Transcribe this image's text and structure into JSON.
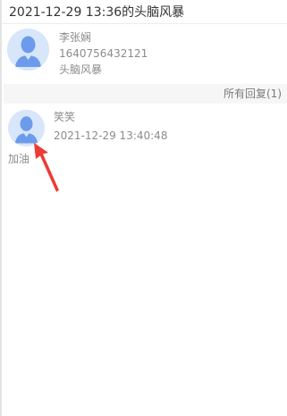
{
  "page_title": "2021-12-29 13:36的头脑风暴",
  "post": {
    "avatar": "default-user-avatar",
    "author": "李张娴",
    "id": "1640756432121",
    "topic": "头脑风暴"
  },
  "replies_header": {
    "label": "所有回复(1)"
  },
  "replies": [
    {
      "avatar": "default-user-avatar",
      "author": "笑笑",
      "time": "2021-12-29 13:40:48",
      "content": "加油"
    }
  ],
  "annotation": {
    "type": "red-arrow",
    "color": "#ee3b34",
    "target": "reply-avatar"
  },
  "colors": {
    "avatar_bg": "#d7e6fa",
    "avatar_figure": "#6d9bec",
    "meta_text": "#8c8c8c",
    "reply_bar_bg": "#f6f6f6"
  }
}
